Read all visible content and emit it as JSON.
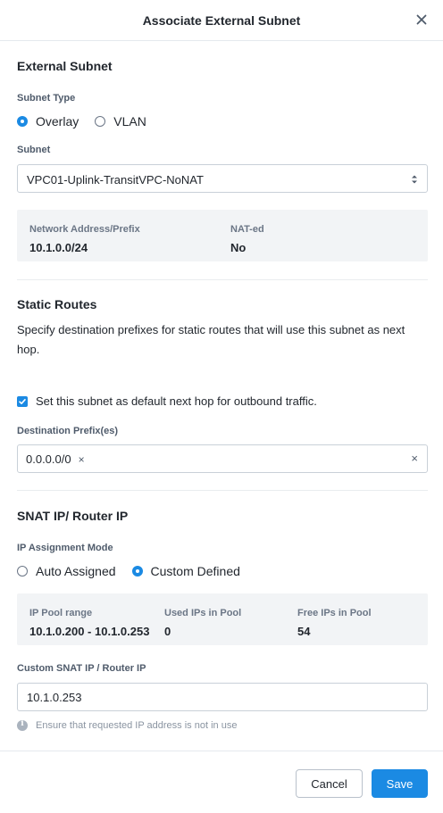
{
  "dialog": {
    "title": "Associate External Subnet"
  },
  "external_subnet": {
    "section_title": "External Subnet",
    "subnet_type_label": "Subnet Type",
    "subnet_type_options": [
      {
        "label": "Overlay",
        "checked": true
      },
      {
        "label": "VLAN",
        "checked": false
      }
    ],
    "subnet_label": "Subnet",
    "subnet_selected": "VPC01-Uplink-TransitVPC-NoNAT",
    "info": {
      "network_label": "Network Address/Prefix",
      "network_value": "10.1.0.0/24",
      "nat_label": "NAT-ed",
      "nat_value": "No"
    }
  },
  "static_routes": {
    "section_title": "Static Routes",
    "description": "Specify destination prefixes for static routes that will use this subnet as next hop.",
    "default_hop_label": "Set this subnet as default next hop for outbound traffic.",
    "default_hop_checked": true,
    "destination_label": "Destination Prefix(es)",
    "destination_tags": [
      "0.0.0.0/0"
    ],
    "tag_remove_glyph": "×",
    "clear_all_glyph": "×"
  },
  "snat": {
    "section_title": "SNAT IP/ Router IP",
    "mode_label": "IP Assignment Mode",
    "mode_options": [
      {
        "label": "Auto Assigned",
        "checked": false
      },
      {
        "label": "Custom Defined",
        "checked": true
      }
    ],
    "pool": {
      "range_label": "IP Pool range",
      "range_value": "10.1.0.200 - 10.1.0.253",
      "used_label": "Used IPs in Pool",
      "used_value": "0",
      "free_label": "Free IPs in Pool",
      "free_value": "54"
    },
    "custom_ip_label": "Custom SNAT IP / Router IP",
    "custom_ip_value": "10.1.0.253",
    "help_text": "Ensure that requested IP address is not in use"
  },
  "footer": {
    "cancel_label": "Cancel",
    "save_label": "Save"
  },
  "colors": {
    "accent": "#1b8ae3",
    "info_bg": "#f2f4f6",
    "text": "#22272e"
  },
  "icons": {
    "close": "close-icon",
    "select_arrows": "sort-arrows-icon",
    "checkbox": "checkmark-icon",
    "help": "info-icon"
  }
}
